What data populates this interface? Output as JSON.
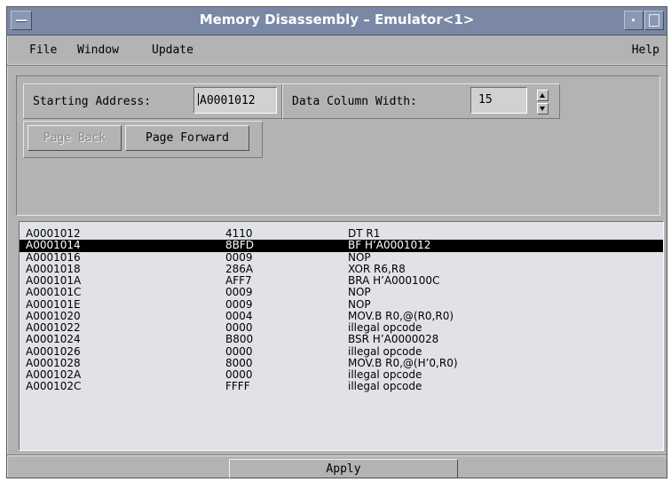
{
  "window": {
    "title": "Memory Disassembly – Emulator<1>"
  },
  "menubar": {
    "file": "File",
    "window": "Window",
    "update": "Update",
    "help": "Help"
  },
  "controls": {
    "starting_address_label": "Starting Address:",
    "starting_address_value": "A0001012",
    "data_column_width_label": "Data Column Width:",
    "data_column_width_value": "15",
    "page_back_label": "Page Back",
    "page_forward_label": "Page Forward"
  },
  "listing": {
    "selected_index": 1,
    "rows": [
      {
        "address": "A0001012",
        "data": "4110",
        "instruction": "DT R1"
      },
      {
        "address": "A0001014",
        "data": "8BFD",
        "instruction": "BF H’A0001012"
      },
      {
        "address": "A0001016",
        "data": "0009",
        "instruction": "NOP"
      },
      {
        "address": "A0001018",
        "data": "286A",
        "instruction": "XOR R6,R8"
      },
      {
        "address": "A000101A",
        "data": "AFF7",
        "instruction": "BRA H’A000100C"
      },
      {
        "address": "A000101C",
        "data": "0009",
        "instruction": "NOP"
      },
      {
        "address": "A000101E",
        "data": "0009",
        "instruction": "NOP"
      },
      {
        "address": "A0001020",
        "data": "0004",
        "instruction": "MOV.B R0,@(R0,R0)"
      },
      {
        "address": "A0001022",
        "data": "0000",
        "instruction": "illegal opcode"
      },
      {
        "address": "A0001024",
        "data": "B800",
        "instruction": "BSR H’A0000028"
      },
      {
        "address": "A0001026",
        "data": "0000",
        "instruction": "illegal opcode"
      },
      {
        "address": "A0001028",
        "data": "8000",
        "instruction": "MOV.B R0,@(H’0,R0)"
      },
      {
        "address": "A000102A",
        "data": "0000",
        "instruction": "illegal opcode"
      },
      {
        "address": "A000102C",
        "data": "FFFF",
        "instruction": "illegal opcode"
      }
    ]
  },
  "footer": {
    "apply_label": "Apply"
  }
}
